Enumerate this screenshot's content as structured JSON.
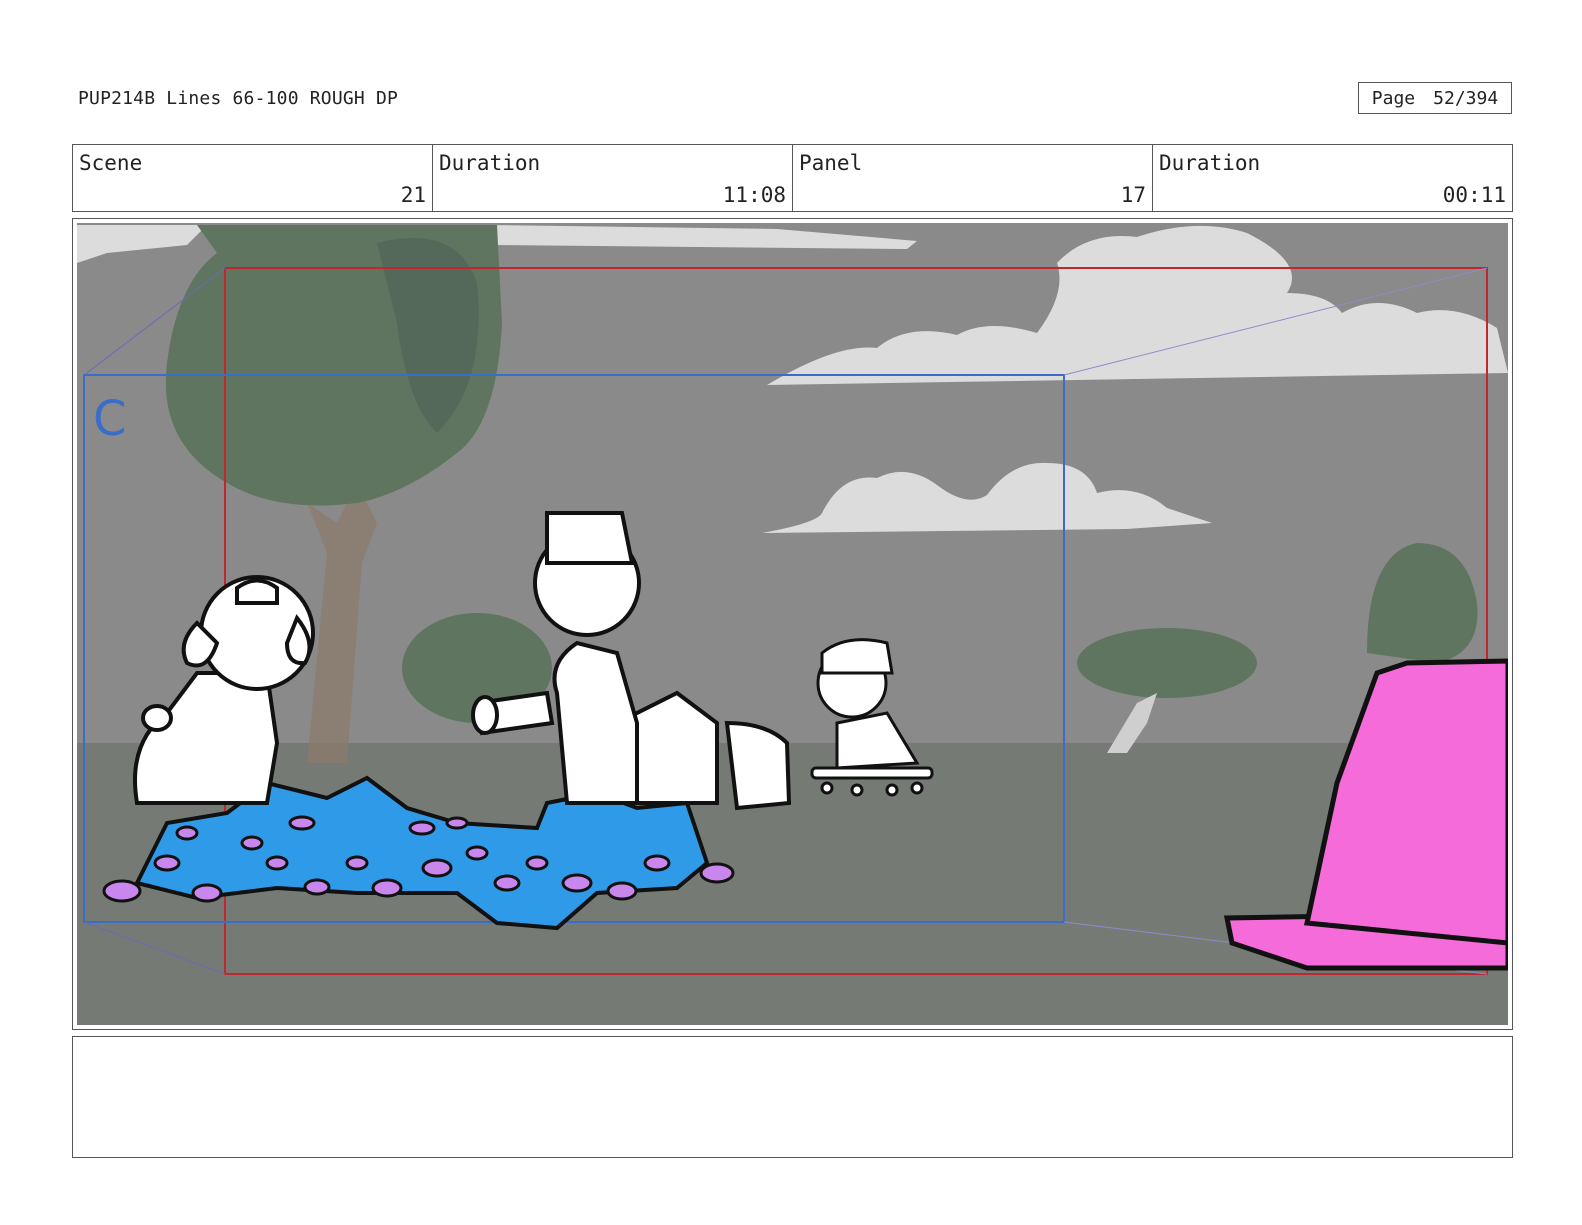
{
  "header": {
    "title": "PUP214B Lines 66-100 ROUGH DP",
    "page_label": "Page",
    "page_value": "52/394"
  },
  "info": [
    {
      "label": "Scene",
      "value": "21"
    },
    {
      "label": "Duration",
      "value": "11:08"
    },
    {
      "label": "Panel",
      "value": "17"
    },
    {
      "label": "Duration",
      "value": "00:11"
    }
  ],
  "panel": {
    "camera_label": "C",
    "colors": {
      "sky": "#8a8a8a",
      "ground": "#757a75",
      "cloud": "#dcdcdc",
      "tree": "#5f7560",
      "rubble_blue": "#2f9be8",
      "pebble_purple": "#c887ec",
      "cone_pink": "#f46bd9",
      "frame_red": "#c0282d",
      "frame_blue": "#3a6dc8"
    }
  },
  "notes": {
    "text": ""
  }
}
